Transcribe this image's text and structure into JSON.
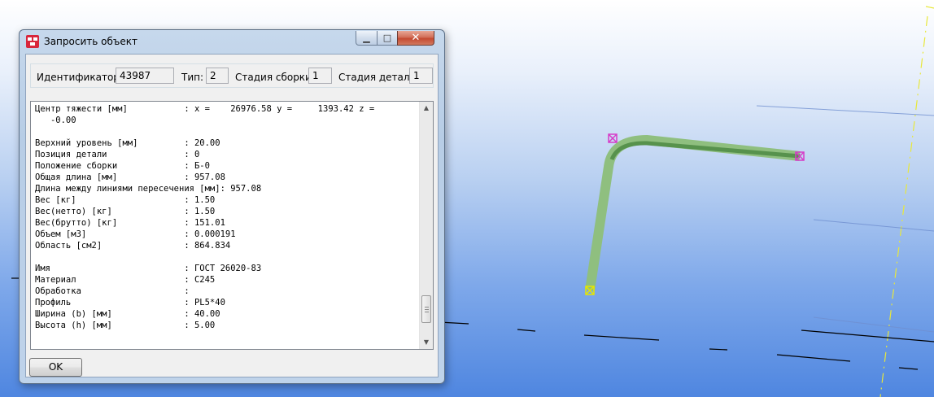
{
  "dialog": {
    "title": "Запросить объект",
    "buttons": {
      "minimize": "▁",
      "maximize": "□",
      "close": "✕"
    },
    "fields": {
      "id_label": "Идентификатор:",
      "id_value": "43987",
      "type_label": "Тип:",
      "type_value": "2",
      "assembly_stage_label": "Стадия сборки:",
      "assembly_stage_value": "1",
      "part_stage_label": "Стадия детали:",
      "part_stage_value": "1"
    },
    "report_lines": [
      "Центр тяжести [мм]           : x =    26976.58 y =     1393.42 z =",
      "   -0.00",
      "",
      "Верхний уровень [мм]         : 20.00",
      "Позиция детали               : 0",
      "Положение сборки             : Б-0",
      "Общая длина [мм]             : 957.08",
      "Длина между линиями пересечения [мм]: 957.08",
      "Вес [кг]                     : 1.50",
      "Вес(нетто) [кг]              : 1.50",
      "Вес(брутто) [кг]             : 151.01",
      "Объем [м3]                   : 0.000191",
      "Область [см2]                : 864.834",
      "",
      "Имя                          : ГОСТ 26020-83",
      "Материал                     : С245",
      "Обработка                    :",
      "Профиль                      : PL5*40",
      "Ширина (b) [мм]              : 40.00",
      "Высота (h) [мм]              : 5.00"
    ],
    "ok_label": "OK"
  },
  "colors": {
    "beam": "#8fbf7f",
    "beam_dark": "#4e8a44",
    "handle_start": "#e6e600",
    "handle_end": "#d63cc8",
    "grid_line": "#f0f03c"
  }
}
